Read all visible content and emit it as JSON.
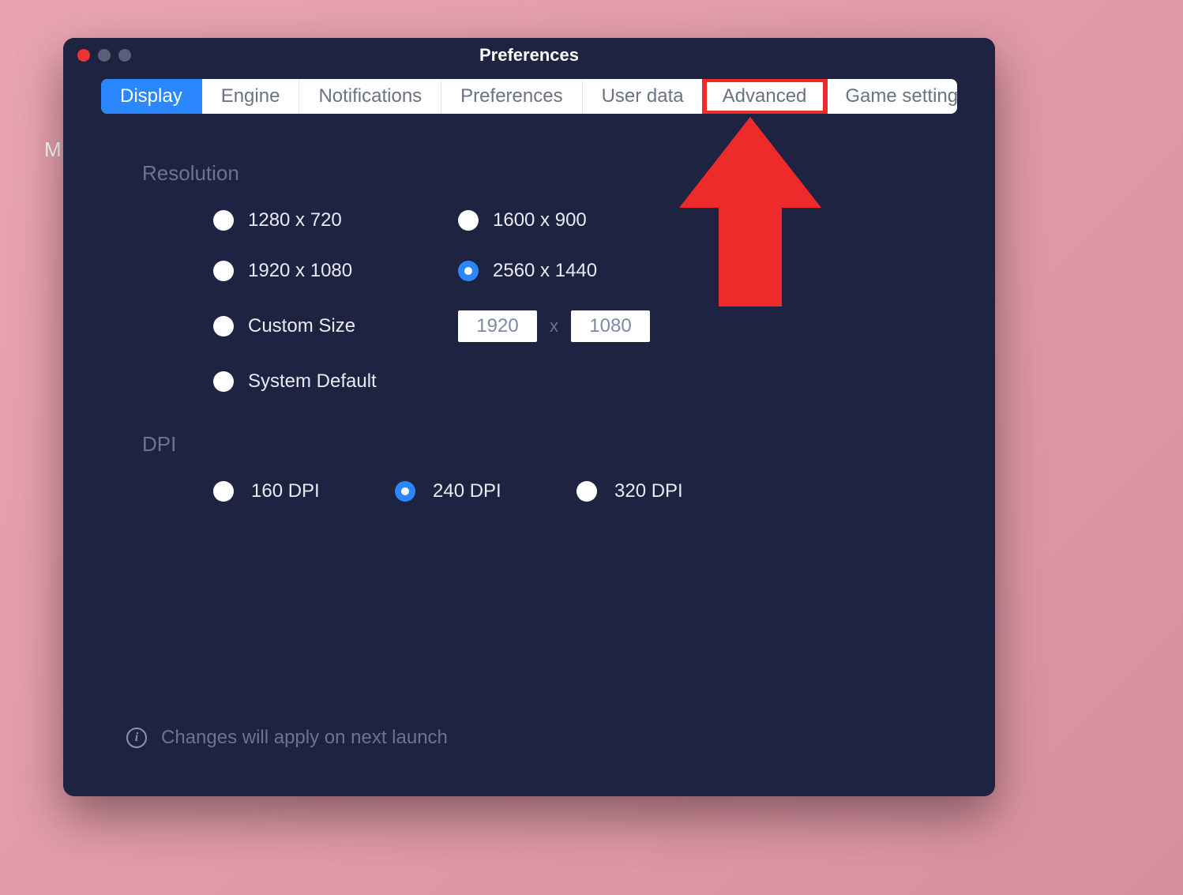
{
  "window": {
    "title": "Preferences"
  },
  "background": {
    "partial_char": "M"
  },
  "tabs": [
    {
      "label": "Display",
      "active": true
    },
    {
      "label": "Engine",
      "active": false
    },
    {
      "label": "Notifications",
      "active": false
    },
    {
      "label": "Preferences",
      "active": false
    },
    {
      "label": "User data",
      "active": false
    },
    {
      "label": "Advanced",
      "active": false,
      "highlighted": true
    },
    {
      "label": "Game settings",
      "active": false
    }
  ],
  "sections": {
    "resolution": {
      "title": "Resolution",
      "options": [
        {
          "label": "1280 x 720",
          "selected": false
        },
        {
          "label": "1600 x 900",
          "selected": false
        },
        {
          "label": "1920 x 1080",
          "selected": false
        },
        {
          "label": "2560 x 1440",
          "selected": true
        },
        {
          "label": "Custom Size",
          "selected": false,
          "custom_width": "1920",
          "custom_height": "1080"
        },
        {
          "label": "System Default",
          "selected": false
        }
      ],
      "custom_separator": "x"
    },
    "dpi": {
      "title": "DPI",
      "options": [
        {
          "label": "160 DPI",
          "selected": false
        },
        {
          "label": "240 DPI",
          "selected": true
        },
        {
          "label": "320 DPI",
          "selected": false
        }
      ]
    }
  },
  "footer": {
    "note": "Changes will apply on next launch"
  },
  "annotation": {
    "highlighted_tab": "Advanced",
    "arrow_color": "#ee2a2a"
  }
}
